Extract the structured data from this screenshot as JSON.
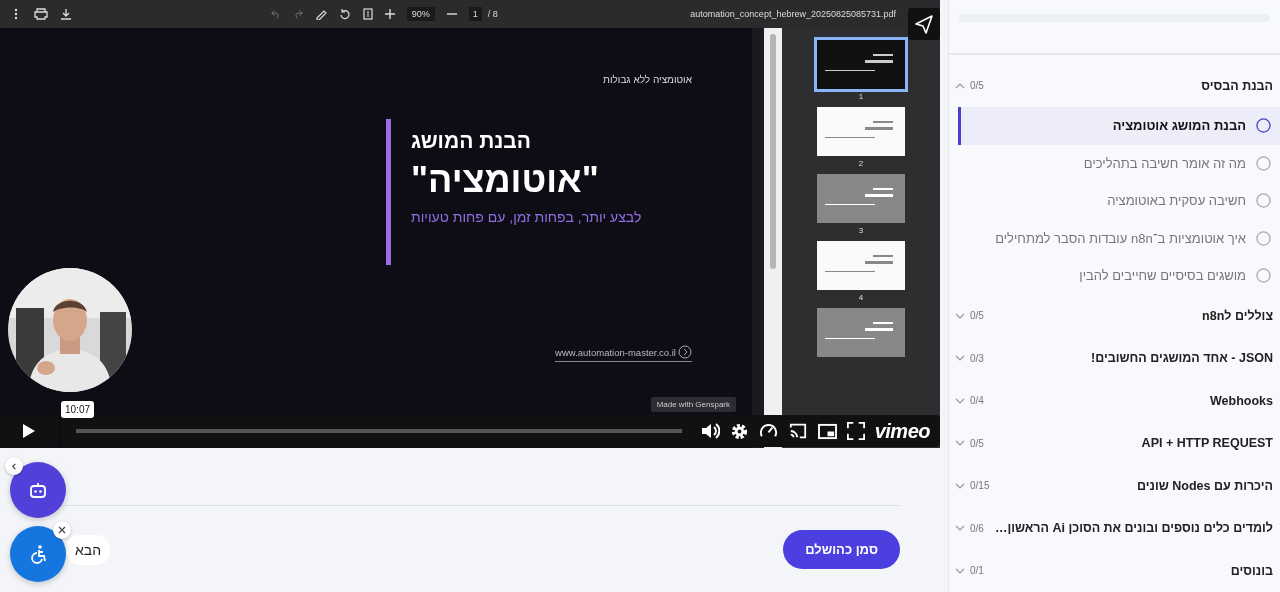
{
  "pdf_viewer": {
    "file_name": "automation_concept_hebrew_20250825085731.pdf",
    "zoom": "90%",
    "page": "1",
    "page_total": "/ 8",
    "slide": {
      "tagline": "אוטומציה ללא גבולות",
      "heading": "הבנת המושג",
      "title": "\"אוטומציה\"",
      "subtitle": "לבצע יותר, בפחות זמן, עם פחות טעויות",
      "url": "www.automation-master.co.il",
      "badge": "Made with Genspark"
    },
    "thumbnails": [
      {
        "number": "1",
        "kind": "dark",
        "selected": true
      },
      {
        "number": "2",
        "kind": "light",
        "selected": false
      },
      {
        "number": "3",
        "kind": "gray",
        "selected": false
      },
      {
        "number": "4",
        "kind": "light",
        "selected": false
      },
      {
        "kind": "gray",
        "selected": false
      }
    ]
  },
  "video_player": {
    "time_tooltip": "10:07",
    "level": 0,
    "brand": "vimeo"
  },
  "actions": {
    "complete_button": "סמן כהושלם",
    "next_button": "הבא"
  },
  "sidebar": {
    "progress": {
      "level": 0
    },
    "sections": [
      {
        "title": "הבנת הבסיס",
        "count": "0/5",
        "expanded": true,
        "lessons": [
          {
            "title": "הבנת המושג אוטומציה",
            "selected": true
          },
          {
            "title": "מה זה אומר חשיבה בתהליכים",
            "selected": false
          },
          {
            "title": "חשיבה עסקית באוטומציה",
            "selected": false
          },
          {
            "title": "איך אוטומציות ב־n8n עובדות הסבר למתחילים",
            "selected": false
          },
          {
            "title": "מושגים בסיסיים שחייבים להבין",
            "selected": false
          }
        ]
      },
      {
        "title": "צוללים לn8n",
        "count": "0/5",
        "expanded": false
      },
      {
        "title": "JSON - אחד המושגים החשובים!",
        "count": "0/3",
        "expanded": false
      },
      {
        "title": "Webhooks",
        "count": "0/4",
        "expanded": false
      },
      {
        "title": "API + HTTP REQUEST",
        "count": "0/5",
        "expanded": false
      },
      {
        "title": "היכרות עם Nodes שונים",
        "count": "0/15",
        "expanded": false
      },
      {
        "title": "לומדים כלים נוספים ובונים את הסוכן Ai הראשון…",
        "count": "0/6",
        "expanded": false
      },
      {
        "title": "בונוסים",
        "count": "0/1",
        "expanded": false
      }
    ]
  }
}
